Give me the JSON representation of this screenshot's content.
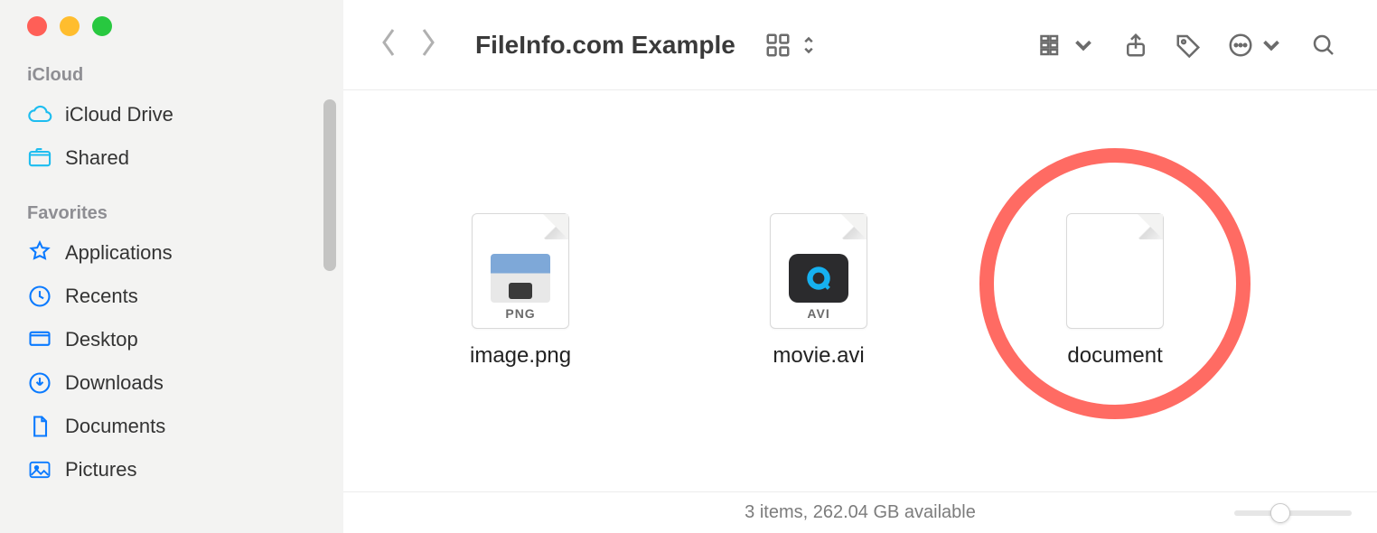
{
  "sidebar": {
    "sections": [
      {
        "label": "iCloud",
        "items": [
          {
            "label": "iCloud Drive",
            "icon": "cloud-icon"
          },
          {
            "label": "Shared",
            "icon": "shared-folder-icon"
          }
        ]
      },
      {
        "label": "Favorites",
        "items": [
          {
            "label": "Applications",
            "icon": "applications-icon"
          },
          {
            "label": "Recents",
            "icon": "recents-icon"
          },
          {
            "label": "Desktop",
            "icon": "desktop-icon"
          },
          {
            "label": "Downloads",
            "icon": "downloads-icon"
          },
          {
            "label": "Documents",
            "icon": "documents-icon"
          },
          {
            "label": "Pictures",
            "icon": "pictures-icon"
          }
        ]
      }
    ]
  },
  "toolbar": {
    "title": "FileInfo.com Example"
  },
  "files": [
    {
      "name": "image.png",
      "badge": "PNG",
      "kind": "png"
    },
    {
      "name": "movie.avi",
      "badge": "AVI",
      "kind": "avi"
    },
    {
      "name": "document",
      "badge": "",
      "kind": "blank",
      "highlighted": true
    }
  ],
  "status": {
    "text": "3 items, 262.04 GB available"
  },
  "annotation": {
    "circle_color": "#ff6b63"
  }
}
